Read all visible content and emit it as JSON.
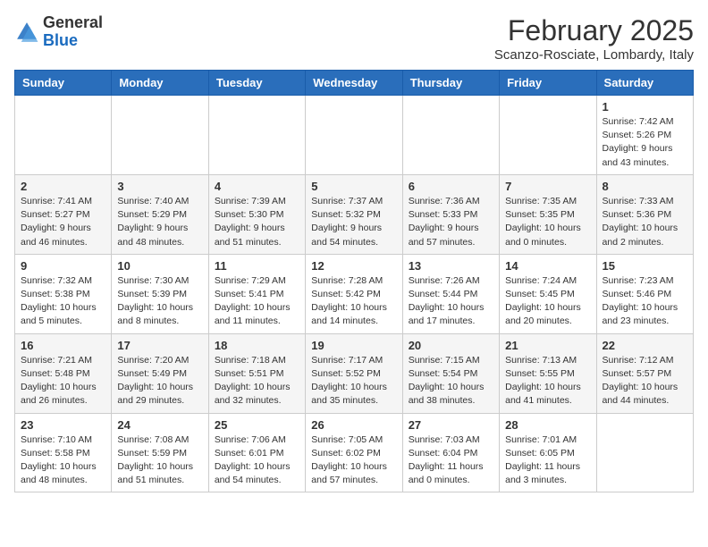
{
  "header": {
    "logo_general": "General",
    "logo_blue": "Blue",
    "month_title": "February 2025",
    "location": "Scanzo-Rosciate, Lombardy, Italy"
  },
  "days_of_week": [
    "Sunday",
    "Monday",
    "Tuesday",
    "Wednesday",
    "Thursday",
    "Friday",
    "Saturday"
  ],
  "weeks": [
    [
      {
        "day": "",
        "info": ""
      },
      {
        "day": "",
        "info": ""
      },
      {
        "day": "",
        "info": ""
      },
      {
        "day": "",
        "info": ""
      },
      {
        "day": "",
        "info": ""
      },
      {
        "day": "",
        "info": ""
      },
      {
        "day": "1",
        "info": "Sunrise: 7:42 AM\nSunset: 5:26 PM\nDaylight: 9 hours and 43 minutes."
      }
    ],
    [
      {
        "day": "2",
        "info": "Sunrise: 7:41 AM\nSunset: 5:27 PM\nDaylight: 9 hours and 46 minutes."
      },
      {
        "day": "3",
        "info": "Sunrise: 7:40 AM\nSunset: 5:29 PM\nDaylight: 9 hours and 48 minutes."
      },
      {
        "day": "4",
        "info": "Sunrise: 7:39 AM\nSunset: 5:30 PM\nDaylight: 9 hours and 51 minutes."
      },
      {
        "day": "5",
        "info": "Sunrise: 7:37 AM\nSunset: 5:32 PM\nDaylight: 9 hours and 54 minutes."
      },
      {
        "day": "6",
        "info": "Sunrise: 7:36 AM\nSunset: 5:33 PM\nDaylight: 9 hours and 57 minutes."
      },
      {
        "day": "7",
        "info": "Sunrise: 7:35 AM\nSunset: 5:35 PM\nDaylight: 10 hours and 0 minutes."
      },
      {
        "day": "8",
        "info": "Sunrise: 7:33 AM\nSunset: 5:36 PM\nDaylight: 10 hours and 2 minutes."
      }
    ],
    [
      {
        "day": "9",
        "info": "Sunrise: 7:32 AM\nSunset: 5:38 PM\nDaylight: 10 hours and 5 minutes."
      },
      {
        "day": "10",
        "info": "Sunrise: 7:30 AM\nSunset: 5:39 PM\nDaylight: 10 hours and 8 minutes."
      },
      {
        "day": "11",
        "info": "Sunrise: 7:29 AM\nSunset: 5:41 PM\nDaylight: 10 hours and 11 minutes."
      },
      {
        "day": "12",
        "info": "Sunrise: 7:28 AM\nSunset: 5:42 PM\nDaylight: 10 hours and 14 minutes."
      },
      {
        "day": "13",
        "info": "Sunrise: 7:26 AM\nSunset: 5:44 PM\nDaylight: 10 hours and 17 minutes."
      },
      {
        "day": "14",
        "info": "Sunrise: 7:24 AM\nSunset: 5:45 PM\nDaylight: 10 hours and 20 minutes."
      },
      {
        "day": "15",
        "info": "Sunrise: 7:23 AM\nSunset: 5:46 PM\nDaylight: 10 hours and 23 minutes."
      }
    ],
    [
      {
        "day": "16",
        "info": "Sunrise: 7:21 AM\nSunset: 5:48 PM\nDaylight: 10 hours and 26 minutes."
      },
      {
        "day": "17",
        "info": "Sunrise: 7:20 AM\nSunset: 5:49 PM\nDaylight: 10 hours and 29 minutes."
      },
      {
        "day": "18",
        "info": "Sunrise: 7:18 AM\nSunset: 5:51 PM\nDaylight: 10 hours and 32 minutes."
      },
      {
        "day": "19",
        "info": "Sunrise: 7:17 AM\nSunset: 5:52 PM\nDaylight: 10 hours and 35 minutes."
      },
      {
        "day": "20",
        "info": "Sunrise: 7:15 AM\nSunset: 5:54 PM\nDaylight: 10 hours and 38 minutes."
      },
      {
        "day": "21",
        "info": "Sunrise: 7:13 AM\nSunset: 5:55 PM\nDaylight: 10 hours and 41 minutes."
      },
      {
        "day": "22",
        "info": "Sunrise: 7:12 AM\nSunset: 5:57 PM\nDaylight: 10 hours and 44 minutes."
      }
    ],
    [
      {
        "day": "23",
        "info": "Sunrise: 7:10 AM\nSunset: 5:58 PM\nDaylight: 10 hours and 48 minutes."
      },
      {
        "day": "24",
        "info": "Sunrise: 7:08 AM\nSunset: 5:59 PM\nDaylight: 10 hours and 51 minutes."
      },
      {
        "day": "25",
        "info": "Sunrise: 7:06 AM\nSunset: 6:01 PM\nDaylight: 10 hours and 54 minutes."
      },
      {
        "day": "26",
        "info": "Sunrise: 7:05 AM\nSunset: 6:02 PM\nDaylight: 10 hours and 57 minutes."
      },
      {
        "day": "27",
        "info": "Sunrise: 7:03 AM\nSunset: 6:04 PM\nDaylight: 11 hours and 0 minutes."
      },
      {
        "day": "28",
        "info": "Sunrise: 7:01 AM\nSunset: 6:05 PM\nDaylight: 11 hours and 3 minutes."
      },
      {
        "day": "",
        "info": ""
      }
    ]
  ]
}
